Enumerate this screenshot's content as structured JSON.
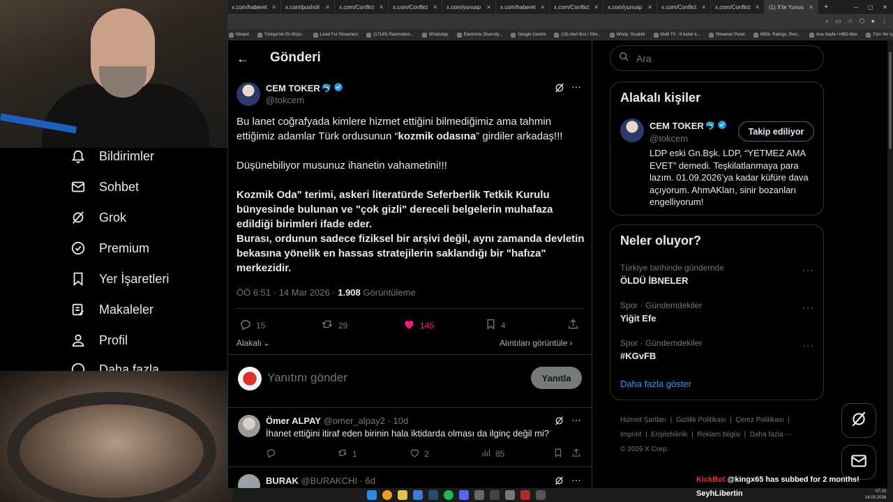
{
  "browser": {
    "tabs": [
      {
        "title": "x.com/haberet"
      },
      {
        "title": "x.com/pusholi"
      },
      {
        "title": "x.com/Conflict"
      },
      {
        "title": "x.com/Conflict"
      },
      {
        "title": "x.com/yunusp"
      },
      {
        "title": "x.com/haberet"
      },
      {
        "title": "x.com/Conflict"
      },
      {
        "title": "x.com/yunusp"
      },
      {
        "title": "x.com/Conflict"
      },
      {
        "title": "x.com/Conflict"
      },
      {
        "title": "(1) X'te Yunus"
      }
    ],
    "bookmarks": [
      "hboard",
      "Türkiye'nin En Büyü...",
      "Livad For Streamers",
      "(17145) Rammstein...",
      "WhatsApp",
      "Electronic Diversity...",
      "Google Gemini",
      "(19) Alert Box / Stre...",
      "Windy: Sıcaklık",
      "Multi TV - 6 haber k...",
      "Streamer Panel",
      "IMDb: Ratings, Revi...",
      "Ana Sayfa • HBO Max",
      "Tüm Yer İşaretleri"
    ]
  },
  "sidenav": {
    "items": [
      {
        "label": "Bildirimler",
        "icon": "bell-icon"
      },
      {
        "label": "Sohbet",
        "icon": "mail-icon"
      },
      {
        "label": "Grok",
        "icon": "grok-icon"
      },
      {
        "label": "Premium",
        "icon": "verified-icon"
      },
      {
        "label": "Yer İşaretleri",
        "icon": "bookmark-icon"
      },
      {
        "label": "Makaleler",
        "icon": "article-icon"
      },
      {
        "label": "Profil",
        "icon": "person-icon"
      },
      {
        "label": "Daha fazla",
        "icon": "more-icon"
      }
    ]
  },
  "header": {
    "title": "Gönderi"
  },
  "post": {
    "name": "CEM TOKER",
    "emoji": "🐬",
    "handle": "@tokcem",
    "line1a": "Bu lanet coğrafyada kimlere hizmet ettiğini bilmediğimiz ama tahmin",
    "line1b_pre": "ettiğimiz adamlar Türk ordusunun “",
    "line1b_bold": "kozmik odasına",
    "line1b_post": "” girdiler arkadaş!!!",
    "line2": "Düşünebiliyor musunuz ihanetin vahametini!!!",
    "para3": "Kozmik Oda\" terimi, askeri literatürde Seferberlik Tetkik Kurulu bünyesinde bulunan ve \"çok gizli\" dereceli belgelerin muhafaza edildiği birimleri ifade eder.",
    "para4": "Burası, ordunun sadece fiziksel bir arşivi değil, aynı zamanda devletin bekasına yönelik en hassas stratejilerin saklandığı bir \"hafıza\" merkezidir.",
    "time": "ÖÖ 6:51 · 14 Mar 2026 · ",
    "views": "1.908",
    "views_label": " Görüntüleme",
    "replies": "15",
    "reposts": "29",
    "likes": "145",
    "bookmarks": "4",
    "sort_label": "Alakalı",
    "quotes_link": "Alıntıları görüntüle",
    "like_color": "#f91880"
  },
  "composer": {
    "placeholder": "Yanıtını gönder",
    "button": "Yanıtla"
  },
  "replies": [
    {
      "name": "Ömer ALPAY",
      "handle": "@omer_alpay2 · 10d",
      "text": "İhanet ettiğini itiraf eden birinin hala iktidarda olması da ilginç değil mi?",
      "replies": "",
      "reposts": "1",
      "likes": "2",
      "views": "85"
    },
    {
      "name": "BURAK",
      "handle": "@BURAKCHI · 6d"
    }
  ],
  "search": {
    "placeholder": "Ara"
  },
  "related": {
    "title": "Alakalı kişiler",
    "name": "CEM TOKER",
    "emoji": "🐬",
    "handle": "@tokcem",
    "button": "Takip ediliyor",
    "bio": "LDP eski Gn.Bşk. LDP, “YETMEZ AMA EVET” demedi. Teşkilatlanmaya para lazım. 01.09.2026’ya kadar küfüre dava açıyorum. AhmAKları, sinir bozanları engelliyorum!"
  },
  "trends": {
    "title": "Neler oluyor?",
    "items": [
      {
        "meta": "Türkiye tarihinde gündemde",
        "name": "ÖLDÜ İBNELER"
      },
      {
        "meta": "Spor · Gündemdekiler",
        "name": "Yiğit Efe"
      },
      {
        "meta": "Spor · Gündemdekiler",
        "name": "#KGvFB"
      }
    ],
    "more": "Daha fazla göster"
  },
  "footer": {
    "links": [
      "Hizmet Şartları",
      "Gizlilik Politikası",
      "Çerez Politikası",
      "Imprint",
      "Erişilebilirlik",
      "Reklam bilgisi",
      "Daha fazla ···"
    ],
    "copyright": "© 2026 X Corp."
  },
  "overlay": {
    "bot": "KickBot",
    "message": "@kingx65 has subbed for 2 months!",
    "streamer": "SeyhLibertin"
  },
  "taskbar": {
    "time": "07:10",
    "date": "14.03.2026"
  }
}
